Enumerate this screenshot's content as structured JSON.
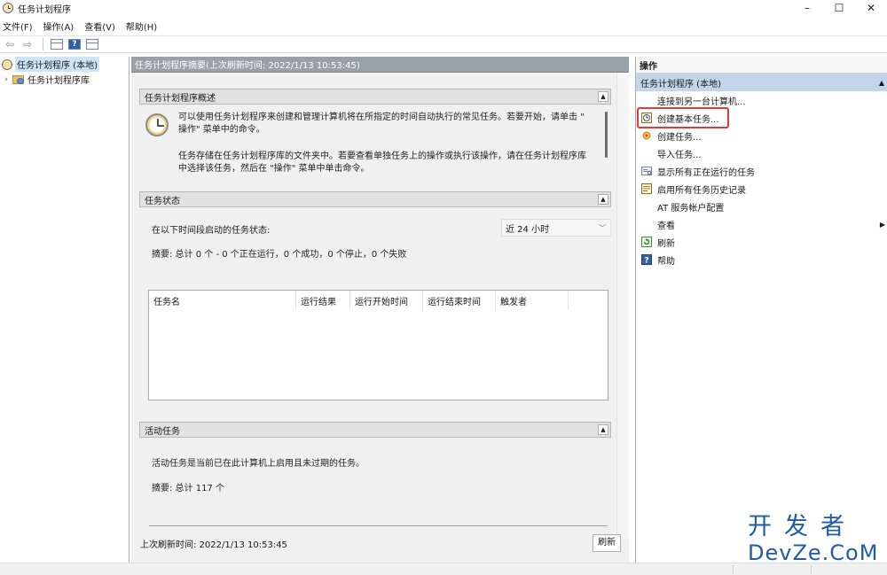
{
  "window": {
    "title": "任务计划程序",
    "controls": {
      "minimize": "–",
      "maximize": "☐",
      "close": "✕"
    }
  },
  "menu": [
    "文件(F)",
    "操作(A)",
    "查看(V)",
    "帮助(H)"
  ],
  "toolbar": {
    "back_icon": "arrow-left-icon",
    "forward_icon": "arrow-right-icon",
    "back_glyph": "⇦",
    "forward_glyph": "⇨",
    "help_glyph": "?"
  },
  "tree": {
    "root": "任务计划程序 (本地)",
    "child": "任务计划程序库",
    "expander": "›"
  },
  "center": {
    "header": "任务计划程序摘要(上次刷新时间: 2022/1/13 10:53:45)",
    "overview": {
      "title": "任务计划程序概述",
      "para1_line1": "可以使用任务计划程序来创建和管理计算机将在所指定的时间自动执行的常见任务。若要开始，请单击 \"",
      "para1_line2": "操作\" 菜单中的命令。",
      "para2_line1": "任务存储在任务计划程序库的文件夹中。若要查看单独任务上的操作或执行该操作，请在任务计划程序库",
      "para2_line2": "中选择该任务，然后在 \"操作\" 菜单中单击命令。"
    },
    "status": {
      "title": "任务状态",
      "range_label": "在以下时间段启动的任务状态:",
      "range_value": "近 24 小时",
      "summary": "摘要: 总计 0 个 - 0 个正在运行，0 个成功，0 个停止，0 个失败",
      "columns": [
        "任务名",
        "运行结果",
        "运行开始时间",
        "运行结束时间",
        "触发者"
      ]
    },
    "active": {
      "title": "活动任务",
      "description": "活动任务是当前已在此计算机上启用且未过期的任务。",
      "summary": "摘要: 总计 117 个"
    },
    "last_refresh": "上次刷新时间: 2022/1/13 10:53:45",
    "refresh_button": "刷新"
  },
  "actions": {
    "title": "操作",
    "group": "任务计划程序 (本地)",
    "group_caret": "▲",
    "submenu_arrow": "▶",
    "items": [
      {
        "label": "连接到另一台计算机...",
        "icon": ""
      },
      {
        "label": "创建基本任务...",
        "icon": "clock-wizard-icon"
      },
      {
        "label": "创建任务...",
        "icon": "new-task-icon"
      },
      {
        "label": "导入任务...",
        "icon": ""
      },
      {
        "label": "显示所有正在运行的任务",
        "icon": "running-tasks-icon"
      },
      {
        "label": "启用所有任务历史记录",
        "icon": "history-icon"
      },
      {
        "label": "AT 服务帐户配置",
        "icon": ""
      },
      {
        "label": "查看",
        "icon": ""
      },
      {
        "label": "刷新",
        "icon": "refresh-icon"
      },
      {
        "label": "帮助",
        "icon": "help-icon"
      }
    ]
  },
  "watermark": {
    "cn": "开发者",
    "en": "DevZe.CoM"
  }
}
